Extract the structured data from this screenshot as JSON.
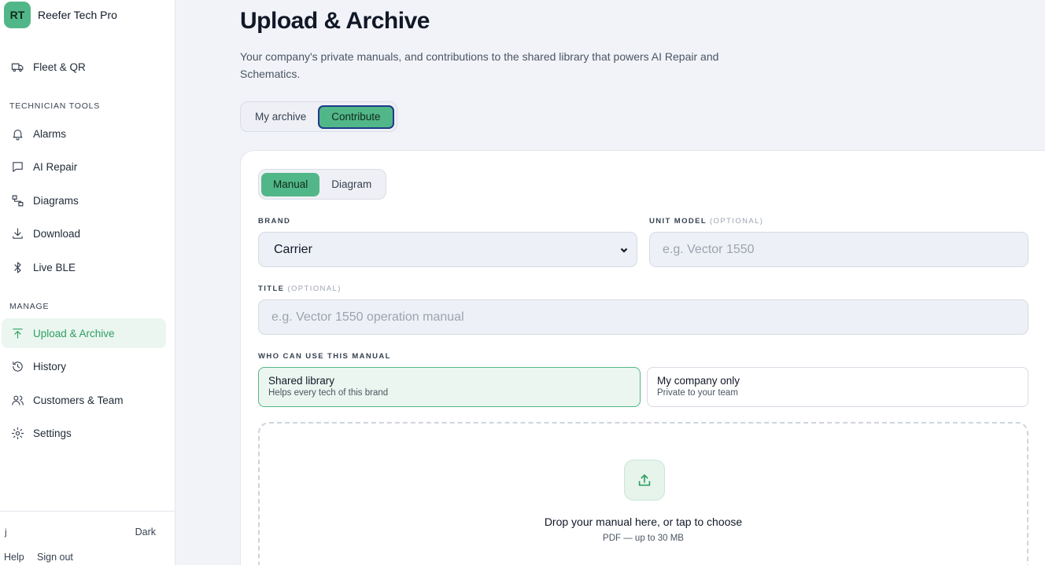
{
  "app": {
    "logo_initials": "RT",
    "name": "Reefer Tech Pro"
  },
  "sidebar": {
    "top_item": {
      "label": "Fleet & QR",
      "icon": "truck-icon"
    },
    "sections": {
      "technician_tools": "TECHNICIAN TOOLS",
      "manage": "MANAGE"
    },
    "technician_items": [
      {
        "label": "Alarms",
        "icon": "bell-icon"
      },
      {
        "label": "AI Repair",
        "icon": "chat-icon"
      },
      {
        "label": "Diagrams",
        "icon": "diagram-icon"
      },
      {
        "label": "Download",
        "icon": "download-icon"
      },
      {
        "label": "Live BLE",
        "icon": "bluetooth-icon"
      }
    ],
    "manage_items": [
      {
        "label": "Upload & Archive",
        "icon": "upload-icon",
        "active": true
      },
      {
        "label": "History",
        "icon": "history-icon"
      },
      {
        "label": "Customers & Team",
        "icon": "users-icon"
      },
      {
        "label": "Settings",
        "icon": "gear-icon"
      }
    ],
    "footer": {
      "user": "j",
      "theme_toggle": "Dark",
      "help": "Help",
      "sign_out": "Sign out"
    }
  },
  "main": {
    "title": "Upload & Archive",
    "subtitle": "Your company's private manuals, and contributions to the shared library that powers AI Repair and Schematics.",
    "mode_tabs": [
      {
        "label": "My archive",
        "selected": false
      },
      {
        "label": "Contribute",
        "selected": true
      }
    ],
    "type_tabs": [
      {
        "label": "Manual",
        "selected": true
      },
      {
        "label": "Diagram",
        "selected": false
      }
    ],
    "form": {
      "brand_label": "BRAND",
      "brand_value": "Carrier",
      "unit_model_label": "UNIT MODEL",
      "unit_model_optional": "(OPTIONAL)",
      "unit_model_placeholder": "e.g. Vector 1550",
      "title_label": "TITLE",
      "title_optional": "(OPTIONAL)",
      "title_placeholder": "e.g. Vector 1550 operation manual",
      "access_label": "WHO CAN USE THIS MANUAL",
      "access_options": [
        {
          "title": "Shared library",
          "subtitle": "Helps every tech of this brand",
          "selected": true
        },
        {
          "title": "My company only",
          "subtitle": "Private to your team",
          "selected": false
        }
      ],
      "dropzone": {
        "icon": "upload-icon",
        "title": "Drop your manual here, or tap to choose",
        "subtitle": "PDF — up to 30 MB"
      }
    }
  },
  "colors": {
    "accent": "#52b788",
    "accent_text": "#2f9e63",
    "active_bg": "#eaf6ef",
    "focus_ring": "#1e3a8a"
  }
}
